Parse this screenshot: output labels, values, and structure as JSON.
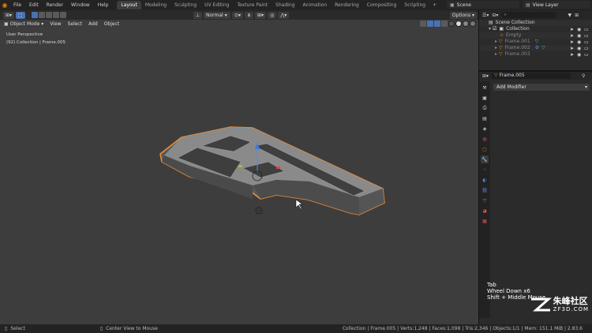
{
  "menubar": {
    "items": [
      "File",
      "Edit",
      "Render",
      "Window",
      "Help"
    ],
    "workspaces": [
      "Layout",
      "Modeling",
      "Sculpting",
      "UV Editing",
      "Texture Paint",
      "Shading",
      "Animation",
      "Rendering",
      "Compositing",
      "Scripting"
    ],
    "active_workspace": "Layout",
    "scene_label": "Scene",
    "view_layer_label": "View Layer"
  },
  "viewport_header": {
    "orientation": "Normal",
    "options_label": "Options"
  },
  "viewport": {
    "mode": "Object Mode",
    "menus": [
      "View",
      "Select",
      "Add",
      "Object"
    ],
    "perspective_label": "User Perspective",
    "collection_label": "(92) Collection | Frame.005"
  },
  "outliner": {
    "items": [
      {
        "label": "Scene Collection",
        "indent": 0,
        "color": "#cfcfcf"
      },
      {
        "label": "Collection",
        "indent": 1,
        "color": "#cfcfcf"
      },
      {
        "label": "Empty",
        "indent": 2,
        "color": "#8a8a8a"
      },
      {
        "label": "Frame.001",
        "indent": 2,
        "color": "#8a8a8a"
      },
      {
        "label": "Frame.002",
        "indent": 2,
        "color": "#8a8a8a"
      },
      {
        "label": "Frame.003",
        "indent": 2,
        "color": "#8a8a8a"
      }
    ]
  },
  "properties": {
    "object_name": "Frame.005",
    "add_modifier_label": "Add Modifier"
  },
  "hint_overlay": {
    "lines": [
      "Tab",
      "Wheel Down x6",
      "Shift + Middle Mouse"
    ]
  },
  "statusbar": {
    "select_label": "Select",
    "center_label": "Center View to Mouse",
    "stats": "Collection | Frame.005 | Verts:1,248 | Faces:1,098 | Tris:2,346 | Objects:1/1 | Mem: 151.1 MiB | 2.83.6"
  },
  "watermark": {
    "brand_cn": "朱峰社区",
    "brand_en": "ZF3D.COM"
  },
  "colors": {
    "accent_orange": "#e87d0d",
    "selection_outline": "#f0903a",
    "active_blue": "#4772b3",
    "viewport_bg": "#3d3d3d"
  }
}
